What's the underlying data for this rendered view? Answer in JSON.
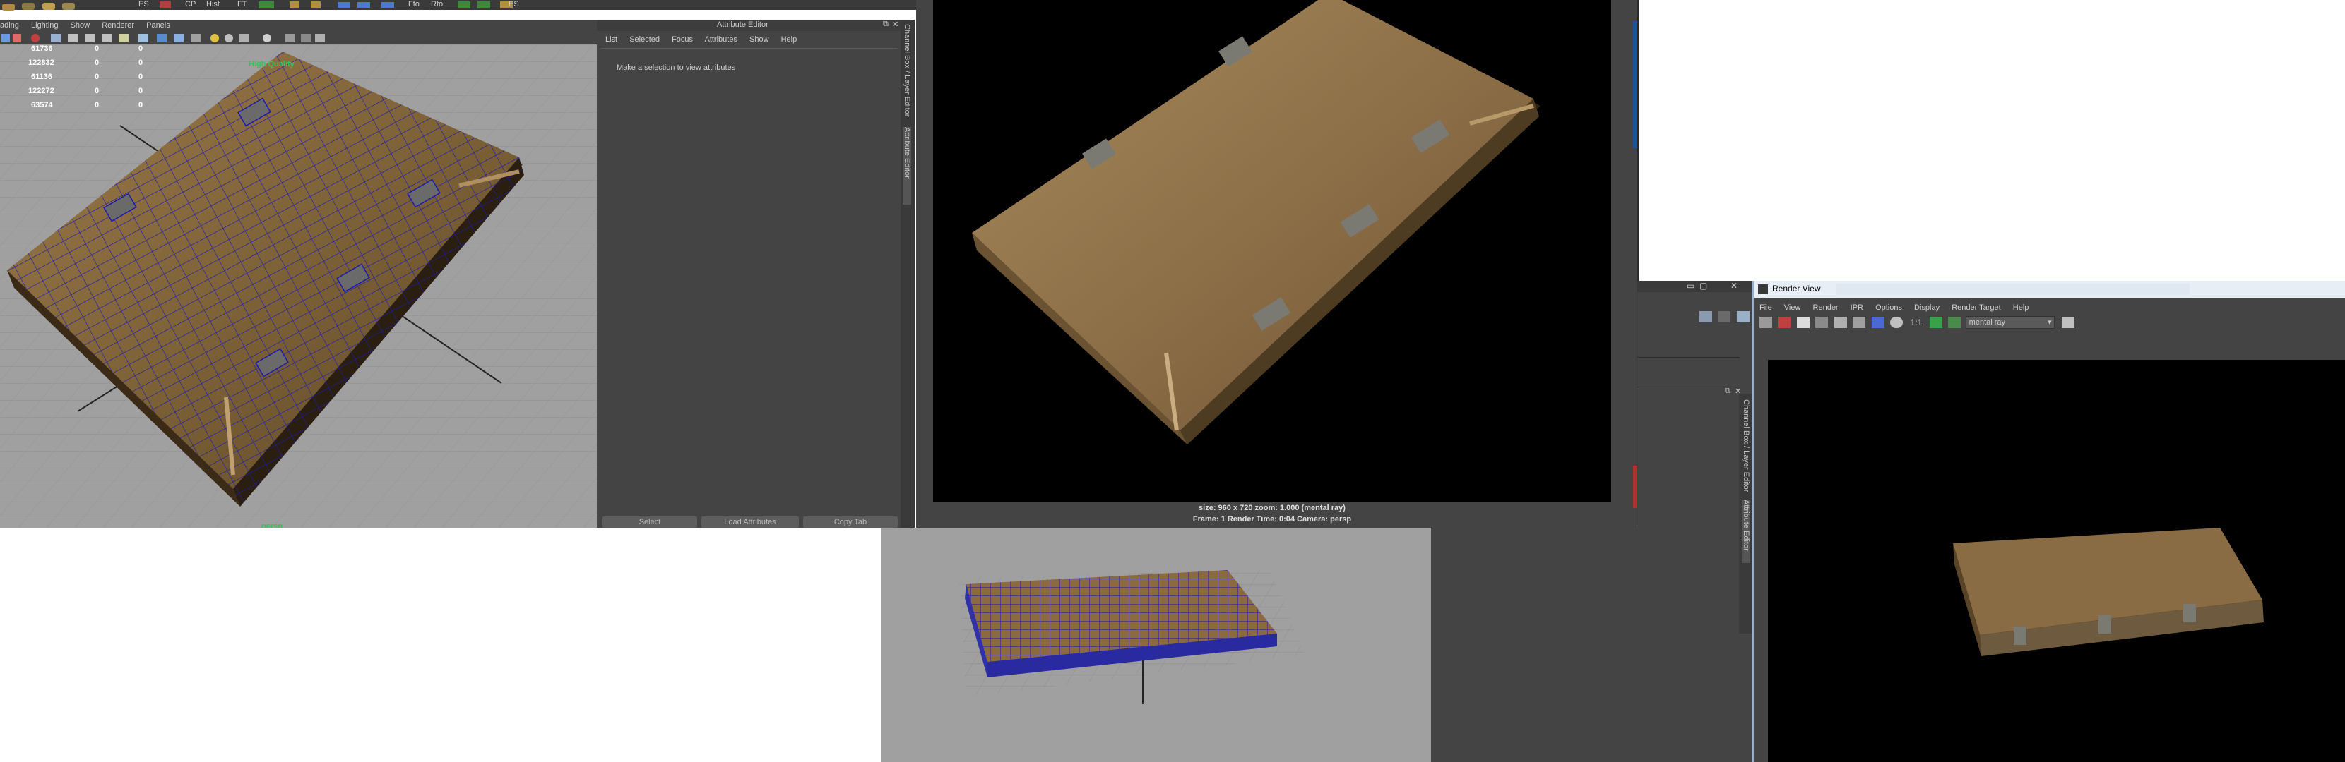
{
  "maya_top": {
    "shelf_labels": [
      "ES",
      "CP",
      "Hist",
      "FT",
      "Fto",
      "Rto",
      "ES"
    ],
    "viewport_menu": [
      "ading",
      "Lighting",
      "Show",
      "Renderer",
      "Panels"
    ],
    "hud": {
      "quality": "High Quality",
      "rows": [
        {
          "a": "61736",
          "b": "0",
          "c": "0"
        },
        {
          "a": "122832",
          "b": "0",
          "c": "0"
        },
        {
          "a": "61136",
          "b": "0",
          "c": "0"
        },
        {
          "a": "122272",
          "b": "0",
          "c": "0"
        },
        {
          "a": "63574",
          "b": "0",
          "c": "0"
        }
      ],
      "camera_bottom": "persp"
    }
  },
  "attribute_editor": {
    "title": "Attribute Editor",
    "menu": [
      "List",
      "Selected",
      "Focus",
      "Attributes",
      "Show",
      "Help"
    ],
    "message": "Make a selection to view attributes",
    "buttons": [
      "Select",
      "Load Attributes",
      "Copy Tab"
    ],
    "side_tabs": [
      "Channel Box / Layer Editor",
      "Attribute Editor"
    ]
  },
  "render_main": {
    "status_line1": "size: 960 x 720  zoom: 1.000      (mental ray)",
    "status_line2": "Frame: 1      Render Time: 0:04      Camera: persp"
  },
  "lower_viewport": {},
  "right_side_panel": {
    "side_tabs": [
      "Channel Box / Layer Editor",
      "Attribute Editor"
    ]
  },
  "render_view": {
    "title": "Render View",
    "menu": [
      "File",
      "View",
      "Render",
      "IPR",
      "Options",
      "Display",
      "Render Target",
      "Help"
    ],
    "ratio_label": "1:1",
    "renderer_select": "mental ray"
  },
  "colors": {
    "maya_bg": "#444444",
    "viewport_bg": "#a0a0a0",
    "render_bg": "#000000",
    "hud_green": "#37c25a",
    "wire_blue": "#1a1ab0"
  }
}
